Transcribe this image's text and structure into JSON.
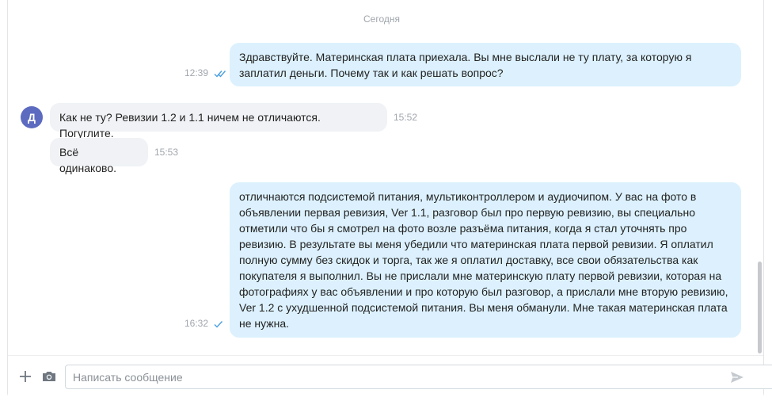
{
  "chat": {
    "date_separator": "Сегодня",
    "avatar_letter": "Д",
    "messages": [
      {
        "direction": "out",
        "text": "Здравствуйте. Материнская плата приехала. Вы мне выслали не ту плату, за которую я заплатил деньги. Почему так и как решать вопрос?",
        "time": "12:39",
        "status": "read"
      },
      {
        "direction": "in",
        "text": "Как не ту? Ревизии 1.2 и 1.1 ничем не отличаются. Погуглите.",
        "time": "15:52"
      },
      {
        "direction": "in",
        "text": "Всё одинаково.",
        "time": "15:53"
      },
      {
        "direction": "out",
        "text": "отличнаются подсистемой питания, мультиконтроллером и аудиочипом. У вас на фото в объявлении первая ревизия, Ver 1.1, разговор был про первую ревизию, вы специально отметили что бы я смотрел на фото возле разъёма питания, когда я стал уточнять про ревизию. В результате вы меня убедили что материнская плата первой ревизии. Я оплатил полную сумму без скидок и торга, так же я оплатил доставку, все свои обязательства как покупателя я выполнил. Вы не прислали мне материнскую плату первой ревизии, которая на фотографиях у вас объявлении и про которую был разговор, а прислали мне вторую ревизию, Ver 1.2 с ухудшенной подсистемой питания. Вы меня обманули. Мне такая материнская плата не нужна.",
        "time": "16:32",
        "status": "sent"
      }
    ]
  },
  "composer": {
    "placeholder": "Написать сообщение"
  },
  "colors": {
    "outgoing_bubble": "#dcf1fd",
    "incoming_bubble": "#f0f2f5",
    "avatar": "#5c6bc0",
    "check": "#4a9fe0"
  }
}
